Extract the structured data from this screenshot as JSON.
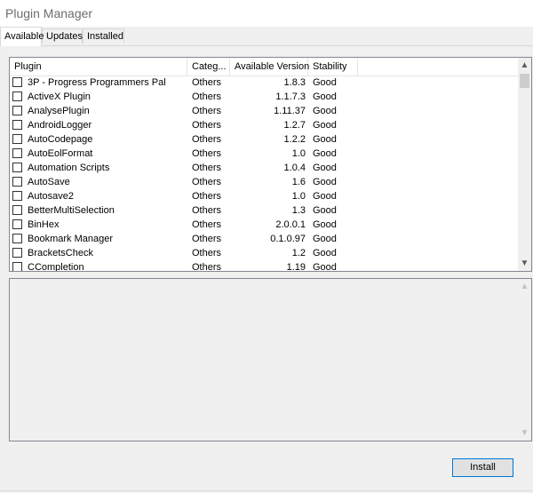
{
  "window": {
    "title": "Plugin Manager"
  },
  "tabs": [
    {
      "label": "Available",
      "active": true
    },
    {
      "label": "Updates",
      "active": false
    },
    {
      "label": "Installed",
      "active": false
    }
  ],
  "plugin_list": {
    "columns": [
      "Plugin",
      "Categ...",
      "Available Version",
      "Stability"
    ],
    "rows": [
      {
        "name": "3P - Progress Programmers Pal",
        "category": "Others",
        "version": "1.8.3",
        "stability": "Good",
        "checked": false
      },
      {
        "name": "ActiveX Plugin",
        "category": "Others",
        "version": "1.1.7.3",
        "stability": "Good",
        "checked": false
      },
      {
        "name": "AnalysePlugin",
        "category": "Others",
        "version": "1.11.37",
        "stability": "Good",
        "checked": false
      },
      {
        "name": "AndroidLogger",
        "category": "Others",
        "version": "1.2.7",
        "stability": "Good",
        "checked": false
      },
      {
        "name": "AutoCodepage",
        "category": "Others",
        "version": "1.2.2",
        "stability": "Good",
        "checked": false
      },
      {
        "name": "AutoEolFormat",
        "category": "Others",
        "version": "1.0",
        "stability": "Good",
        "checked": false
      },
      {
        "name": "Automation Scripts",
        "category": "Others",
        "version": "1.0.4",
        "stability": "Good",
        "checked": false
      },
      {
        "name": "AutoSave",
        "category": "Others",
        "version": "1.6",
        "stability": "Good",
        "checked": false
      },
      {
        "name": "Autosave2",
        "category": "Others",
        "version": "1.0",
        "stability": "Good",
        "checked": false
      },
      {
        "name": "BetterMultiSelection",
        "category": "Others",
        "version": "1.3",
        "stability": "Good",
        "checked": false
      },
      {
        "name": "BinHex",
        "category": "Others",
        "version": "2.0.0.1",
        "stability": "Good",
        "checked": false
      },
      {
        "name": "Bookmark Manager",
        "category": "Others",
        "version": "0.1.0.97",
        "stability": "Good",
        "checked": false
      },
      {
        "name": "BracketsCheck",
        "category": "Others",
        "version": "1.2",
        "stability": "Good",
        "checked": false
      },
      {
        "name": "CCompletion",
        "category": "Others",
        "version": "1.19",
        "stability": "Good",
        "checked": false
      }
    ]
  },
  "icons": {
    "scroll_up": "▲",
    "scroll_down": "▼"
  },
  "description": {
    "text": ""
  },
  "buttons": {
    "install": "Install"
  },
  "colors": {
    "accent": "#0078d7",
    "border": "#828790",
    "background": "#f0f0f0"
  }
}
